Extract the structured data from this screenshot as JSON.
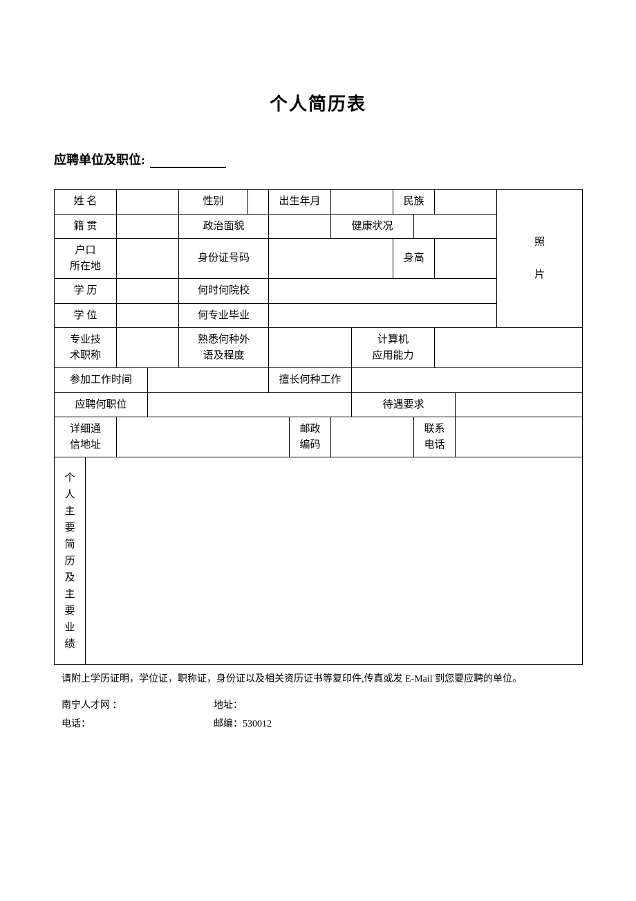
{
  "title": "个人简历表",
  "subtitle": "应聘单位及职位:",
  "labels": {
    "name": "姓 名",
    "gender": "性别",
    "birth": "出生年月",
    "ethnic": "民族",
    "origin": "籍 贯",
    "politics": "政治面貌",
    "health": "健康状况",
    "hukou1": "户口",
    "hukou2": "所在地",
    "idnum": "身份证号码",
    "height": "身高",
    "edu": "学 历",
    "schoolwhen": "何时何院校",
    "degree": "学 位",
    "majorgrad": "何专业毕业",
    "techtitle1": "专业技",
    "techtitle2": "术职称",
    "lang1": "熟悉何种外",
    "lang2": "语及程度",
    "computer1": "计算机",
    "computer2": "应用能力",
    "worktime": "参加工作时间",
    "goodat": "擅长何种工作",
    "applypos": "应聘何职位",
    "salary": "待遇要求",
    "addr1": "详细通",
    "addr2": "信地址",
    "postcode1": "邮政",
    "postcode2": "编码",
    "phone1": "联系",
    "phone2": "电话",
    "photo1": "照",
    "photo2": "片",
    "bio": "个人主要简历及主要业绩"
  },
  "footer": {
    "note": "请附上学历证明，学位证，职称证，身份证以及相关资历证书等复印件,传真或发 E-Mail 到您要应聘的单位。",
    "site": "南宁人才网 ：",
    "addr": "地址：",
    "tel": "电话：",
    "zip": "邮编：530012"
  }
}
